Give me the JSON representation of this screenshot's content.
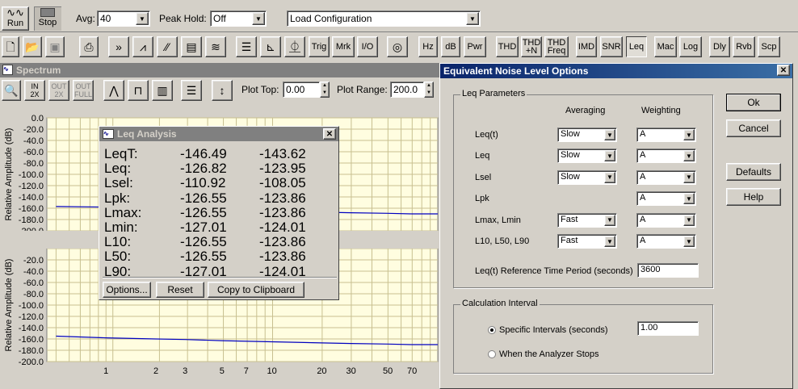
{
  "toolbar": {
    "run": "Run",
    "stop": "Stop",
    "avg_label": "Avg:",
    "avg_value": "40",
    "peak_label": "Peak Hold:",
    "peak_value": "Off",
    "config_value": "Load Configuration"
  },
  "tools": [
    "Trig",
    "Mrk",
    "I/O",
    "Hz",
    "dB",
    "Pwr",
    "THD",
    "THD +N",
    "THD Freq",
    "IMD",
    "SNR",
    "Leq",
    "Mac",
    "Log",
    "Dly",
    "Rvb",
    "Scp"
  ],
  "spectrum": {
    "title": "Spectrum",
    "plot_top_label": "Plot Top:",
    "plot_top": "0.00",
    "plot_range_label": "Plot Range:",
    "plot_range": "200.0",
    "ylabel": "Relative Amplitude (dB)",
    "yticks": [
      "0.0",
      "-20.0",
      "-40.0",
      "-60.0",
      "-80.0",
      "-100.0",
      "-120.0",
      "-140.0",
      "-160.0",
      "-180.0",
      "-200.0"
    ],
    "xticks": [
      "1",
      "2",
      "3",
      "5",
      "7",
      "10",
      "20",
      "30",
      "50",
      "70"
    ]
  },
  "chart_data": [
    {
      "type": "line",
      "ylabel": "Relative Amplitude (dB)",
      "ylim": [
        -200,
        0
      ],
      "xscale": "log",
      "series": [
        {
          "x": [
            0.5,
            1,
            2,
            3,
            5,
            10,
            20,
            30,
            50,
            70,
            100
          ],
          "y": [
            -157,
            -158,
            -160,
            -162,
            -163,
            -165,
            -167,
            -168,
            -169,
            -170,
            -170
          ]
        }
      ]
    },
    {
      "type": "line",
      "ylabel": "Relative Amplitude (dB)",
      "ylim": [
        -200,
        0
      ],
      "xscale": "log",
      "x_ticks": [
        "1",
        "2",
        "3",
        "5",
        "7",
        "10",
        "20",
        "30",
        "50",
        "70"
      ],
      "series": [
        {
          "x": [
            0.5,
            1,
            2,
            3,
            5,
            10,
            20,
            30,
            50,
            70,
            100
          ],
          "y": [
            -155,
            -158,
            -160,
            -161,
            -163,
            -165,
            -167,
            -168,
            -169,
            -170,
            -170
          ]
        }
      ]
    }
  ],
  "leq": {
    "title": "Leq Analysis",
    "rows": [
      {
        "label": "LeqT:",
        "a": "-146.49",
        "b": "-143.62"
      },
      {
        "label": "Leq:",
        "a": "-126.82",
        "b": "-123.95"
      },
      {
        "label": "Lsel:",
        "a": "-110.92",
        "b": "-108.05"
      },
      {
        "label": "Lpk:",
        "a": "-126.55",
        "b": "-123.86"
      },
      {
        "label": "Lmax:",
        "a": "-126.55",
        "b": "-123.86"
      },
      {
        "label": "Lmin:",
        "a": "-127.01",
        "b": "-124.01"
      },
      {
        "label": "L10:",
        "a": "-126.55",
        "b": "-123.86"
      },
      {
        "label": "L50:",
        "a": "-126.55",
        "b": "-123.86"
      },
      {
        "label": "L90:",
        "a": "-127.01",
        "b": "-124.01"
      }
    ],
    "options": "Options...",
    "reset": "Reset",
    "copy": "Copy to Clipboard"
  },
  "dialog": {
    "title": "Equivalent Noise Level Options",
    "group1": "Leq Parameters",
    "averaging": "Averaging",
    "weighting": "Weighting",
    "params": [
      {
        "label": "Leq(t)",
        "avg": "Slow",
        "wt": "A"
      },
      {
        "label": "Leq",
        "avg": "Slow",
        "wt": "A"
      },
      {
        "label": "Lsel",
        "avg": "Slow",
        "wt": "A"
      },
      {
        "label": "Lpk",
        "avg": "",
        "wt": "A"
      },
      {
        "label": "Lmax, Lmin",
        "avg": "Fast",
        "wt": "A"
      },
      {
        "label": "L10, L50, L90",
        "avg": "Fast",
        "wt": "A"
      }
    ],
    "ref_label": "Leq(t) Reference Time Period (seconds)",
    "ref_value": "3600",
    "group2": "Calculation Interval",
    "specific": "Specific Intervals (seconds)",
    "specific_value": "1.00",
    "stops": "When the Analyzer Stops",
    "ok": "Ok",
    "cancel": "Cancel",
    "defaults": "Defaults",
    "help": "Help"
  }
}
